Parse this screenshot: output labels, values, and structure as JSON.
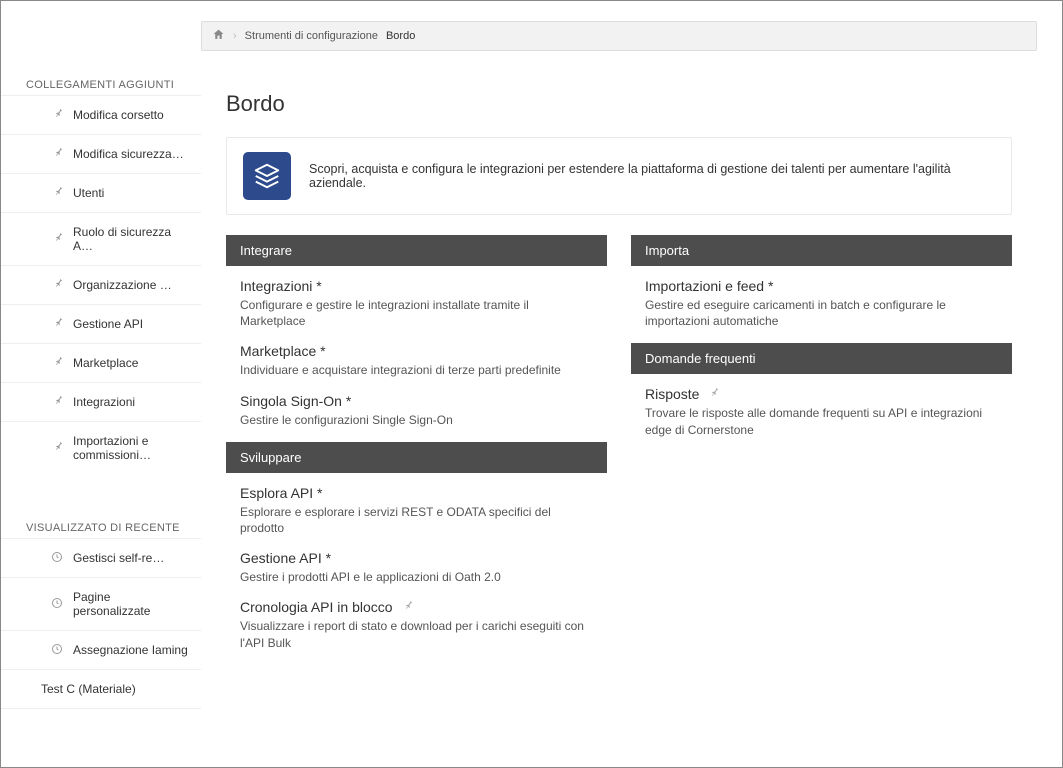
{
  "sidebar": {
    "section1": {
      "title": "COLLEGAMENTI AGGIUNTI",
      "items": [
        {
          "label": "Modifica corsetto"
        },
        {
          "label": "Modifica sicurezza…"
        },
        {
          "label": "Utenti"
        },
        {
          "label": "Ruolo di sicurezza A…"
        },
        {
          "label": "Organizzazione …"
        },
        {
          "label": "Gestione API"
        },
        {
          "label": "Marketplace"
        },
        {
          "label": "Integrazioni"
        },
        {
          "label": "Importazioni e commissioni…"
        }
      ]
    },
    "section2": {
      "title": "VISUALIZZATO DI RECENTE",
      "items": [
        {
          "label": "Gestisci self-re…"
        },
        {
          "label": "Pagine personalizzate"
        },
        {
          "label": "Assegnazione Iaming"
        },
        {
          "label": "Test C (Materiale)"
        }
      ]
    }
  },
  "breadcrumb": {
    "tools": "Strumenti di configurazione",
    "current": "Bordo"
  },
  "page": {
    "title": "Bordo",
    "banner": "Scopri, acquista e configura le integrazioni per estendere la piattaforma di gestione dei talenti per aumentare l'agilità aziendale."
  },
  "left": {
    "integrate": {
      "header": "Integrare",
      "items": [
        {
          "title": "Integrazioni *",
          "desc": "Configurare e gestire le integrazioni installate tramite il Marketplace"
        },
        {
          "title": "Marketplace *",
          "desc": "Individuare e acquistare integrazioni di terze parti predefinite"
        },
        {
          "title": "Singola Sign-On *",
          "desc": "Gestire le configurazioni Single Sign-On"
        }
      ]
    },
    "develop": {
      "header": "Sviluppare",
      "items": [
        {
          "title": "Esplora API *",
          "desc": "Esplorare e esplorare i servizi REST e ODATA specifici del prodotto"
        },
        {
          "title": "Gestione API *",
          "desc": "Gestire i prodotti API e le applicazioni di Oath 2.0"
        },
        {
          "title": "Cronologia API in blocco",
          "desc": "Visualizzare i report di stato e download per i carichi eseguiti con l'API Bulk"
        }
      ]
    }
  },
  "right": {
    "import": {
      "header": "Importa",
      "items": [
        {
          "title": "Importazioni e feed *",
          "desc": "Gestire ed eseguire caricamenti in batch e configurare le importazioni automatiche"
        }
      ]
    },
    "faq": {
      "header": "Domande frequenti",
      "items": [
        {
          "title": "Risposte",
          "desc": "Trovare le risposte alle domande frequenti su API e integrazioni edge di Cornerstone"
        }
      ]
    }
  }
}
